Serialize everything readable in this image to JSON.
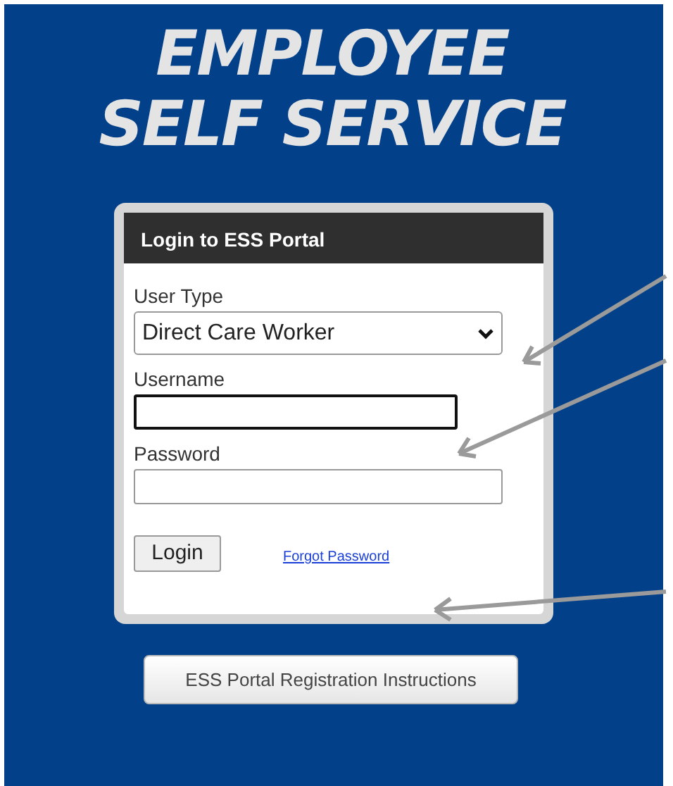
{
  "title": [
    "EMPLOYEE",
    "SELF SERVICE"
  ],
  "login_form": {
    "header": "Login to ESS Portal",
    "fields": [
      {
        "kind": "select",
        "label": "User Type",
        "value": "Direct Care Worker"
      },
      {
        "kind": "text",
        "label": "Username",
        "focused": true
      },
      {
        "kind": "password",
        "label": "Password",
        "focused": false
      }
    ],
    "login_button": "Login",
    "forgot_link": "Forgot Password"
  },
  "registration_button": "ESS Portal Registration Instructions"
}
